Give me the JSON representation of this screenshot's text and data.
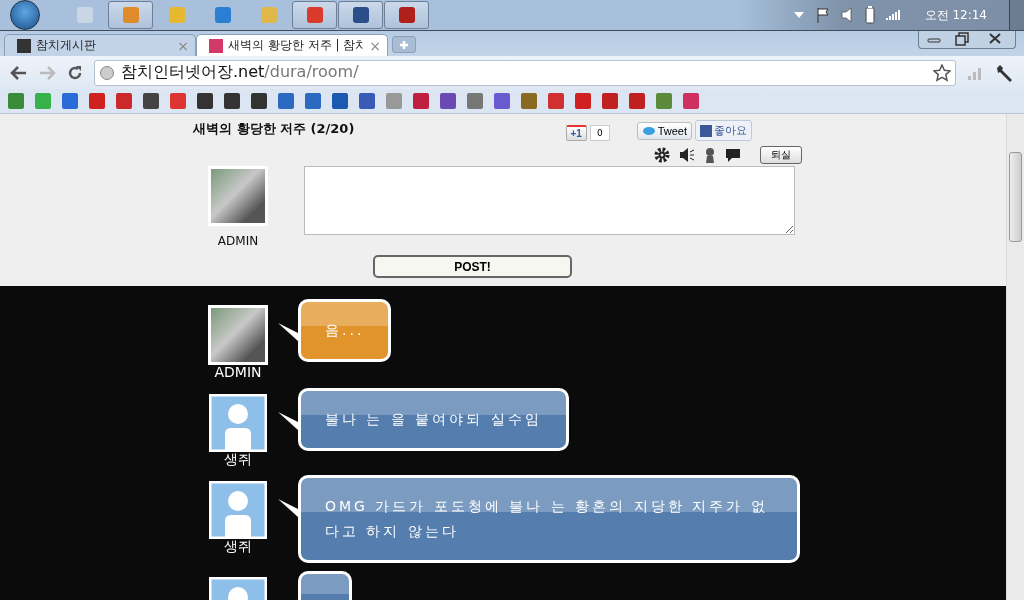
{
  "taskbar": {
    "apps": [
      {
        "running": false
      },
      {
        "running": true
      },
      {
        "running": false
      },
      {
        "running": false
      },
      {
        "running": false
      },
      {
        "running": true
      },
      {
        "running": true
      },
      {
        "running": true
      }
    ],
    "clock": "오전 12:14"
  },
  "tabs": [
    {
      "title": "참치게시판",
      "close": "×",
      "selected": false
    },
    {
      "title": "새벽의 황당한 저주 | 참치",
      "close": "×",
      "selected": true
    }
  ],
  "address": {
    "host": "참치인터넷어장.net",
    "path": "/dura/room/"
  },
  "room": {
    "title": "새벽의 황당한 저주 (2/20)",
    "plusone": "+1",
    "plusone_count": "0",
    "tweet": "Tweet",
    "like": "좋아요",
    "leave": "퇴실",
    "user": "ADMIN",
    "post": "POST!"
  },
  "messages": [
    {
      "name": "ADMIN",
      "kind": "photo",
      "text": "음...",
      "color": "#e8ae5e"
    },
    {
      "name": "생쥐",
      "kind": "default",
      "text": "불나 는 을 붙여야되 실수임",
      "color": "#7b9bc0"
    },
    {
      "name": "생쥐",
      "kind": "default",
      "text": "OMG 가드가 포도청에 불나 는 황혼의 지당한 지주가 없다고 하지 않는다",
      "color": "#7b9bc0"
    },
    {
      "kind": "default",
      "color": "#7b9bc0"
    }
  ]
}
